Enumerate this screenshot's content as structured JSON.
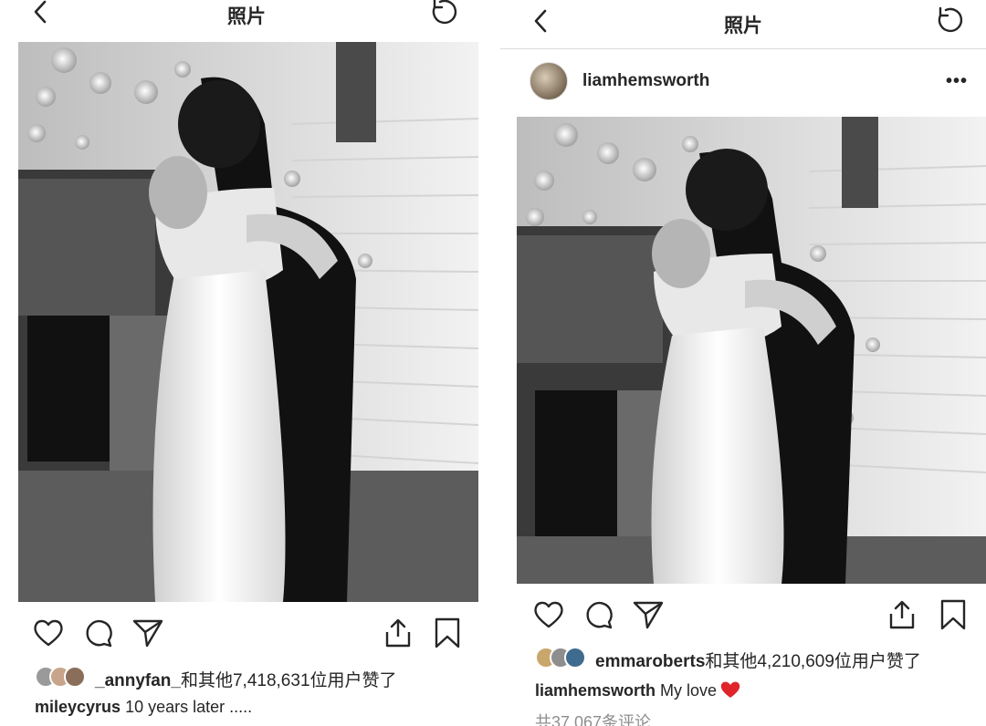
{
  "left": {
    "header": {
      "title": "照片"
    },
    "likes": {
      "username": "_annyfan_",
      "text": "和其他7,418,631位用户赞了"
    },
    "caption": {
      "username": "mileycyrus",
      "text": " 10 years later ....."
    }
  },
  "right": {
    "header": {
      "title": "照片"
    },
    "post": {
      "username": "liamhemsworth",
      "more": "•••"
    },
    "likes": {
      "username": "emmaroberts",
      "text": "和其他4,210,609位用户赞了"
    },
    "caption": {
      "username": "liamhemsworth",
      "text": " My love"
    },
    "comments": "共37,067条评论"
  },
  "icons": {
    "back": "chevron-left-icon",
    "refresh": "refresh-icon",
    "like": "heart-icon",
    "comment": "comment-icon",
    "share": "send-icon",
    "upload": "share-upload-icon",
    "save": "bookmark-icon",
    "caption_emoji": "red-heart-emoji"
  },
  "colors": {
    "text": "#262626",
    "muted": "#8e8e8e",
    "emoji_heart": "#e0242c",
    "divider": "#dbdbdb"
  }
}
